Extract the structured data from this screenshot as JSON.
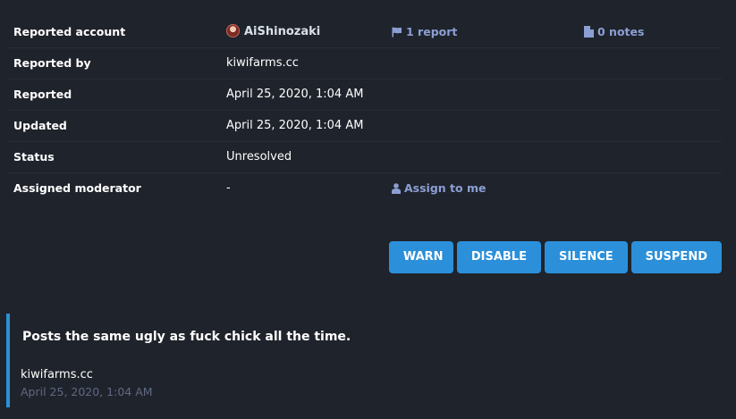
{
  "report": {
    "rows": [
      {
        "label": "Reported account",
        "value": "AiShinozaki",
        "extra1": "1 report",
        "extra2": "0 notes"
      },
      {
        "label": "Reported by",
        "value": "kiwifarms.cc"
      },
      {
        "label": "Reported",
        "value": "April 25, 2020, 1:04 AM"
      },
      {
        "label": "Updated",
        "value": "April 25, 2020, 1:04 AM"
      },
      {
        "label": "Status",
        "value": "Unresolved"
      },
      {
        "label": "Assigned moderator",
        "value": "-",
        "extra1": "Assign to me"
      }
    ]
  },
  "actions": {
    "warn": "WARN",
    "disable": "DISABLE",
    "silence": "SILENCE",
    "suspend": "SUSPEND"
  },
  "comment": {
    "text": "Posts the same ugly as fuck chick all the time.",
    "author": "kiwifarms.cc",
    "date": "April 25, 2020, 1:04 AM"
  },
  "icons": {
    "flag": "flag-icon",
    "notes": "file-icon",
    "assign": "user-icon"
  },
  "colors": {
    "background": "#1f232b",
    "accent": "#2b90d9",
    "link": "#8c9fd4",
    "muted": "#606984"
  }
}
